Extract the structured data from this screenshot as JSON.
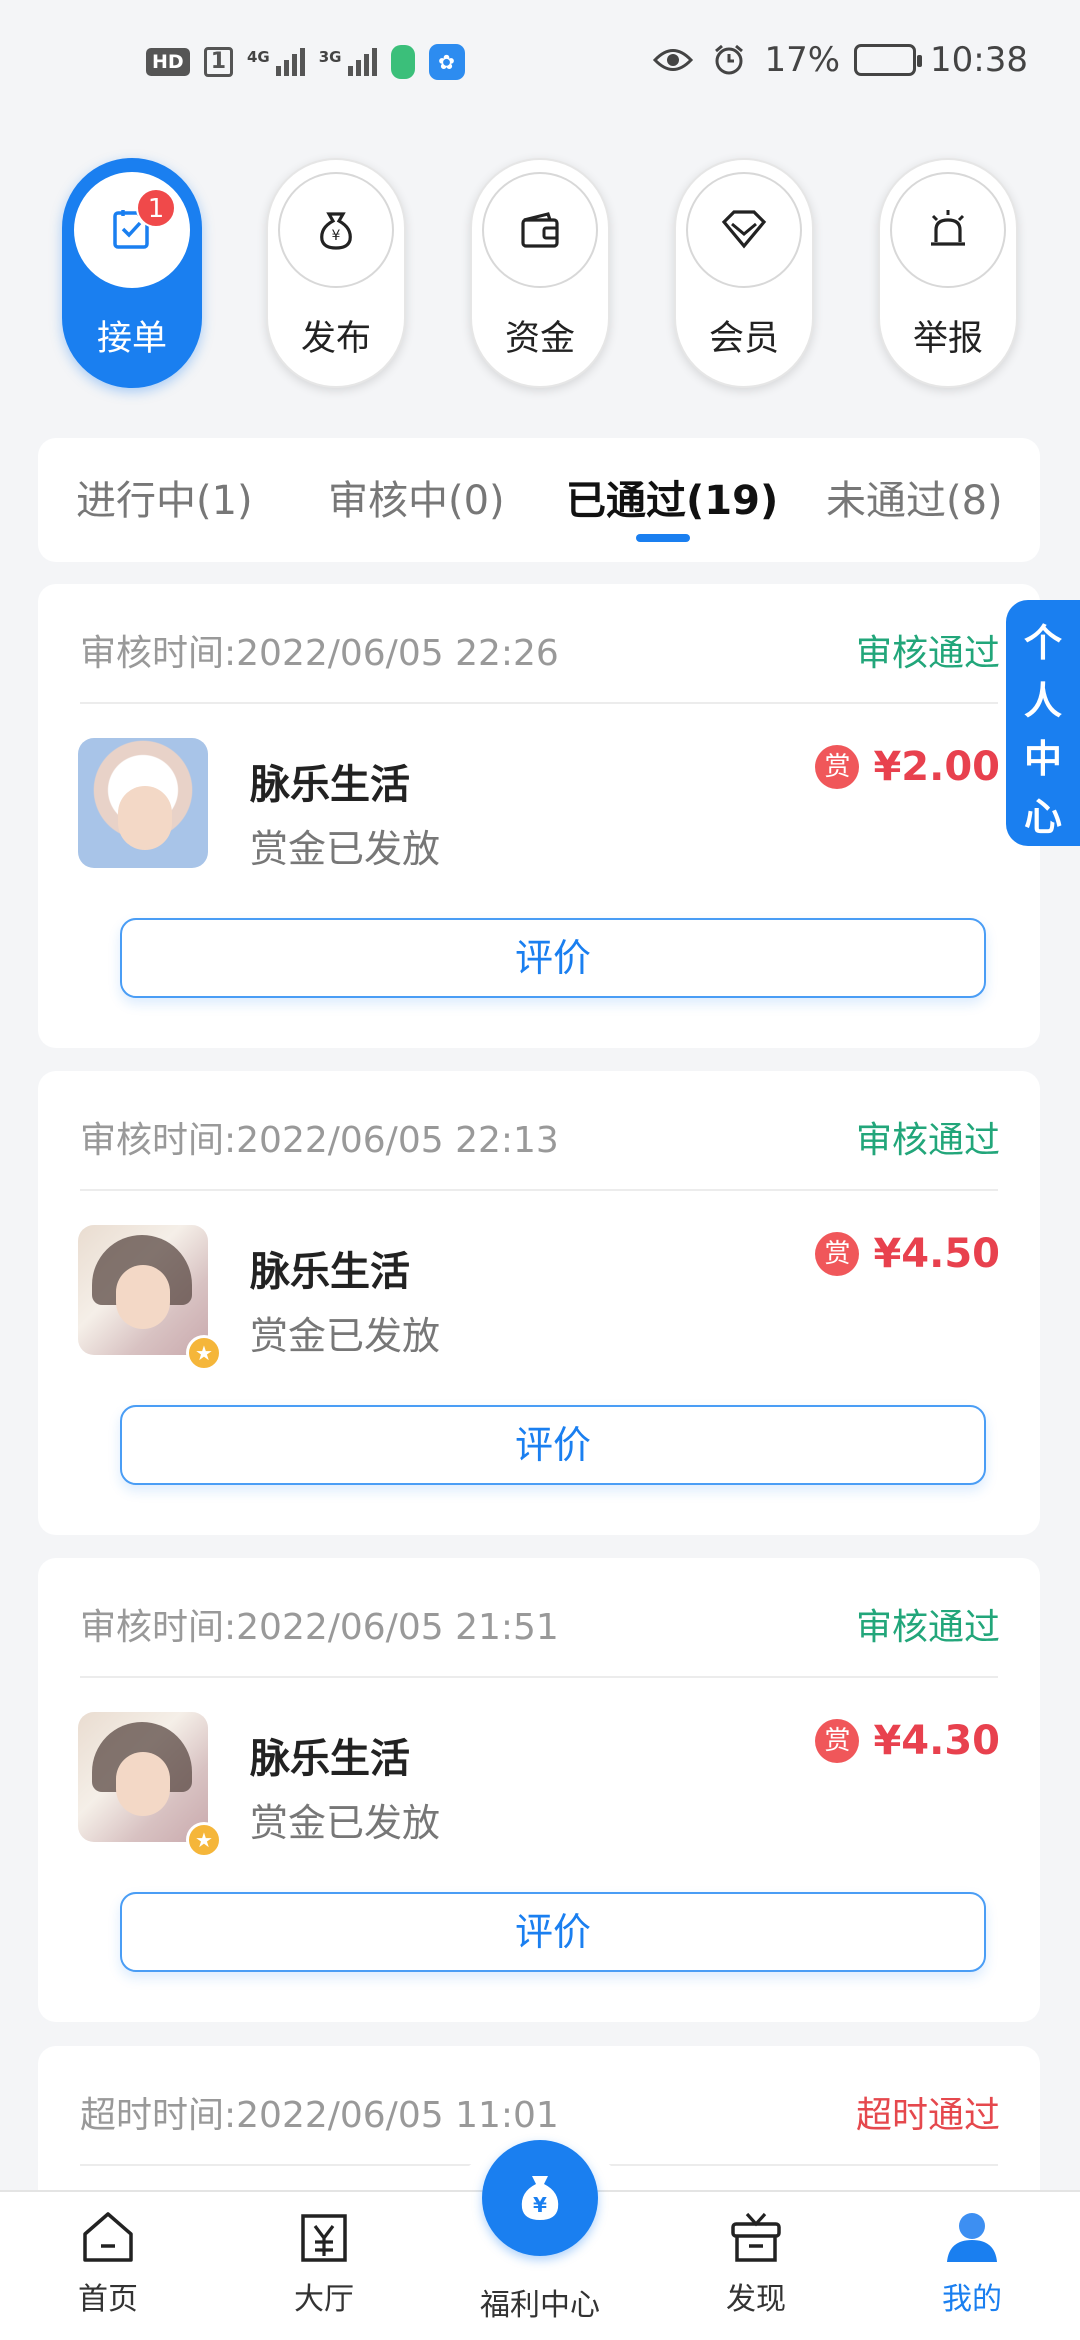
{
  "status_bar": {
    "hd": "HD",
    "sim": "1",
    "net1": "4G",
    "net2": "3G",
    "battery_pct": "17%",
    "battery_level": 0.17,
    "time": "10:38"
  },
  "menu": [
    {
      "label": "接单",
      "badge": "1"
    },
    {
      "label": "发布"
    },
    {
      "label": "资金"
    },
    {
      "label": "会员"
    },
    {
      "label": "举报"
    }
  ],
  "tabs": [
    {
      "label": "进行中(1)"
    },
    {
      "label": "审核中(0)"
    },
    {
      "label": "已通过(19)"
    },
    {
      "label": "未通过(8)"
    }
  ],
  "side_tab": {
    "label": "个人中心"
  },
  "cards": [
    {
      "time": "审核时间:2022/06/05 22:26",
      "status": "审核通过",
      "app": "脉乐生活",
      "sub": "赏金已发放",
      "reward_icon": "赏",
      "amount": "¥2.00",
      "button": "评价"
    },
    {
      "time": "审核时间:2022/06/05 22:13",
      "status": "审核通过",
      "app": "脉乐生活",
      "sub": "赏金已发放",
      "reward_icon": "赏",
      "amount": "¥4.50",
      "button": "评价"
    },
    {
      "time": "审核时间:2022/06/05 21:51",
      "status": "审核通过",
      "app": "脉乐生活",
      "sub": "赏金已发放",
      "reward_icon": "赏",
      "amount": "¥4.30",
      "button": "评价"
    },
    {
      "time": "超时时间:2022/06/05 11:01",
      "status": "超时通过"
    }
  ],
  "nav": [
    {
      "label": "首页"
    },
    {
      "label": "大厅"
    },
    {
      "label": "福利中心"
    },
    {
      "label": "发现"
    },
    {
      "label": "我的"
    }
  ],
  "colors": {
    "accent": "#1a7ff0",
    "pass": "#22a67a",
    "timeout": "#e5484d",
    "reward": "#e8414e"
  }
}
